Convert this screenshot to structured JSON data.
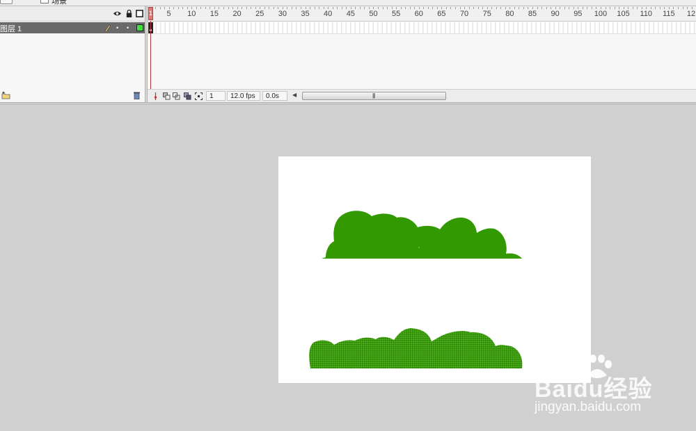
{
  "top_bar": {
    "scene_label": "场景"
  },
  "layers_panel": {
    "layers": [
      {
        "name": "图层 1"
      }
    ]
  },
  "timeline": {
    "ruler_labels": [
      "5",
      "10",
      "15",
      "20",
      "25",
      "30",
      "35",
      "40",
      "45",
      "50",
      "55",
      "60",
      "65",
      "70",
      "75",
      "80",
      "85",
      "90",
      "95",
      "100",
      "105",
      "110",
      "115",
      "12"
    ],
    "playhead_label": "1",
    "current_frame": "1",
    "frame_rate": "12.0 fps",
    "elapsed_time": "0.0s",
    "scroll_grip": "|||"
  },
  "watermark": {
    "brand": "Baidu经验",
    "url": "jingyan.baidu.com"
  },
  "colors": {
    "stage": "#ffffff",
    "workspace": "#d0d0d0",
    "bush_solid": "#339900",
    "bush_dotted": "#2f9a00",
    "layer_selected": "#6a6a6a",
    "layer_color_swatch": "#44dd44"
  }
}
